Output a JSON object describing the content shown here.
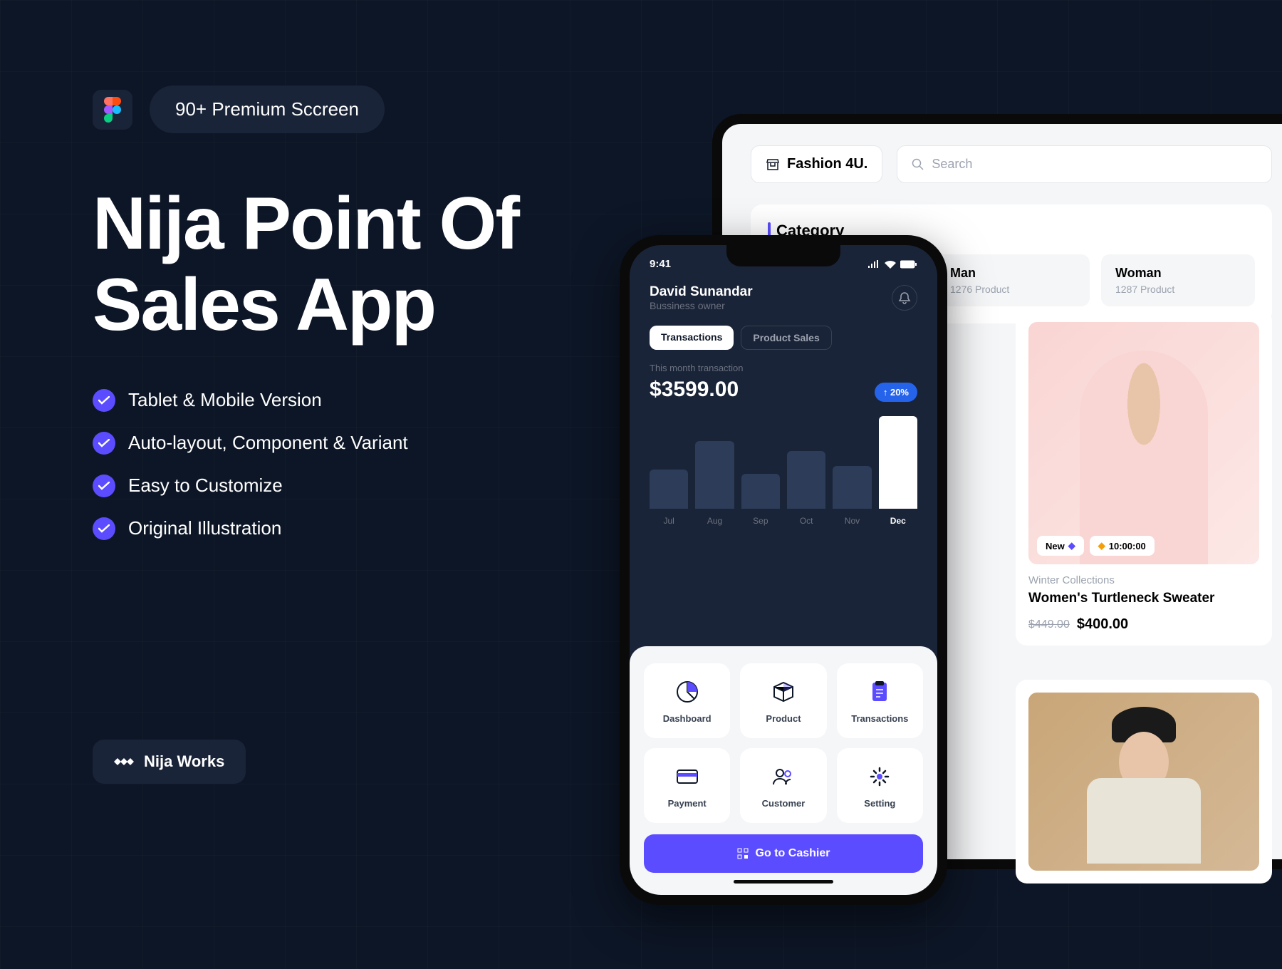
{
  "badge": "90+ Premium Sccreen",
  "title_line1": "Nija Point Of",
  "title_line2": "Sales App",
  "features": [
    "Tablet & Mobile Version",
    "Auto-layout, Component & Variant",
    "Easy to Customize",
    "Original Illustration"
  ],
  "brand": "Nija Works",
  "tablet": {
    "store": "Fashion 4U.",
    "search": "Search",
    "category_title": "Category",
    "categories": [
      {
        "name": "Man",
        "count": "1276 Product"
      },
      {
        "name": "Woman",
        "count": "1287 Product"
      }
    ],
    "product": {
      "badge_new": "New",
      "badge_time": "10:00:00",
      "category": "Winter Collections",
      "name": "Women's Turtleneck Sweater",
      "price_old": "$449.00",
      "price_new": "$400.00"
    }
  },
  "phone": {
    "time": "9:41",
    "user_name": "David Sunandar",
    "user_role": "Bussiness owner",
    "tabs": {
      "active": "Transactions",
      "inactive": "Product Sales"
    },
    "stat_label": "This month transaction",
    "stat_value": "$3599.00",
    "stat_change": "↑ 20%",
    "months": [
      "Jul",
      "Aug",
      "Sep",
      "Oct",
      "Nov",
      "Dec"
    ],
    "menu": [
      "Dashboard",
      "Product",
      "Transactions",
      "Payment",
      "Customer",
      "Setting"
    ],
    "cashier": "Go to Cashier"
  },
  "chart_data": {
    "type": "bar",
    "categories": [
      "Jul",
      "Aug",
      "Sep",
      "Oct",
      "Nov",
      "Dec"
    ],
    "values": [
      55,
      95,
      50,
      80,
      60,
      130
    ],
    "title": "This month transaction",
    "ylabel": "",
    "highlight_index": 5
  }
}
